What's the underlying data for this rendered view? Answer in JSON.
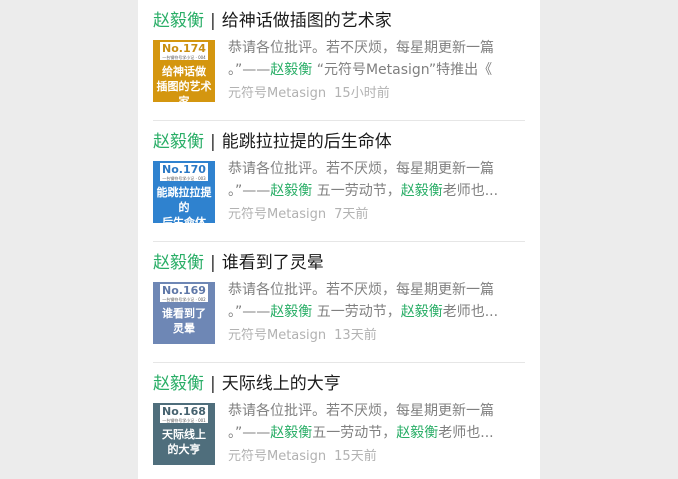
{
  "articles": [
    {
      "author": "赵毅衡",
      "separator": "|",
      "title": "给神话做插图的艺术家",
      "thumb": {
        "number": "No.174",
        "subtitle": "一台钢符号学小记 · 004",
        "caption_line1": "给神话做",
        "caption_line2": "插图的艺术家",
        "bg_color": "#d4960f",
        "number_color": "#c98f12"
      },
      "summary_line1": "恭请各位批评。若不厌烦，每星期更新一篇",
      "summary_line2_prefix": "。”——",
      "summary_line2_hl1": "赵毅衡",
      "summary_line2_mid": " “元符号Metasign”特推出《",
      "summary_line2_hl2": "",
      "summary_line2_suffix": "",
      "source": "元符号Metasign",
      "time": "15小时前"
    },
    {
      "author": "赵毅衡",
      "separator": "|",
      "title": "能跳拉拉提的后生命体",
      "thumb": {
        "number": "No.170",
        "subtitle": "一台钢符号学小记 · 003",
        "caption_line1": "能跳拉拉提的",
        "caption_line2": "后生命体",
        "bg_color": "#2f82cf",
        "number_color": "#2a78c4"
      },
      "summary_line1": "恭请各位批评。若不厌烦，每星期更新一篇",
      "summary_line2_prefix": "。”——",
      "summary_line2_hl1": "赵毅衡",
      "summary_line2_mid": " 五一劳动节，",
      "summary_line2_hl2": "赵毅衡",
      "summary_line2_suffix": "老师也...",
      "source": "元符号Metasign",
      "time": "7天前"
    },
    {
      "author": "赵毅衡",
      "separator": "|",
      "title": "谁看到了灵晕",
      "thumb": {
        "number": "No.169",
        "subtitle": "一台钢符号学小记 · 002",
        "caption_line1": "谁看到了",
        "caption_line2": "灵晕",
        "bg_color": "#6e87b5",
        "number_color": "#5f78a8"
      },
      "summary_line1": "恭请各位批评。若不厌烦，每星期更新一篇",
      "summary_line2_prefix": "。”——",
      "summary_line2_hl1": "赵毅衡",
      "summary_line2_mid": " 五一劳动节，",
      "summary_line2_hl2": "赵毅衡",
      "summary_line2_suffix": "老师也...",
      "source": "元符号Metasign",
      "time": "13天前"
    },
    {
      "author": "赵毅衡",
      "separator": "|",
      "title": "天际线上的大亨",
      "thumb": {
        "number": "No.168",
        "subtitle": "一台钢符号学小记 · 001",
        "caption_line1": "天际线上",
        "caption_line2": "的大亨",
        "bg_color": "#4f6e7c",
        "number_color": "#46626f"
      },
      "summary_line1": "恭请各位批评。若不厌烦，每星期更新一篇",
      "summary_line2_prefix": "。”——",
      "summary_line2_hl1": "赵毅衡",
      "summary_line2_mid": "五一劳动节，",
      "summary_line2_hl2": "赵毅衡",
      "summary_line2_suffix": "老师也...",
      "source": "元符号Metasign",
      "time": "15天前"
    }
  ]
}
